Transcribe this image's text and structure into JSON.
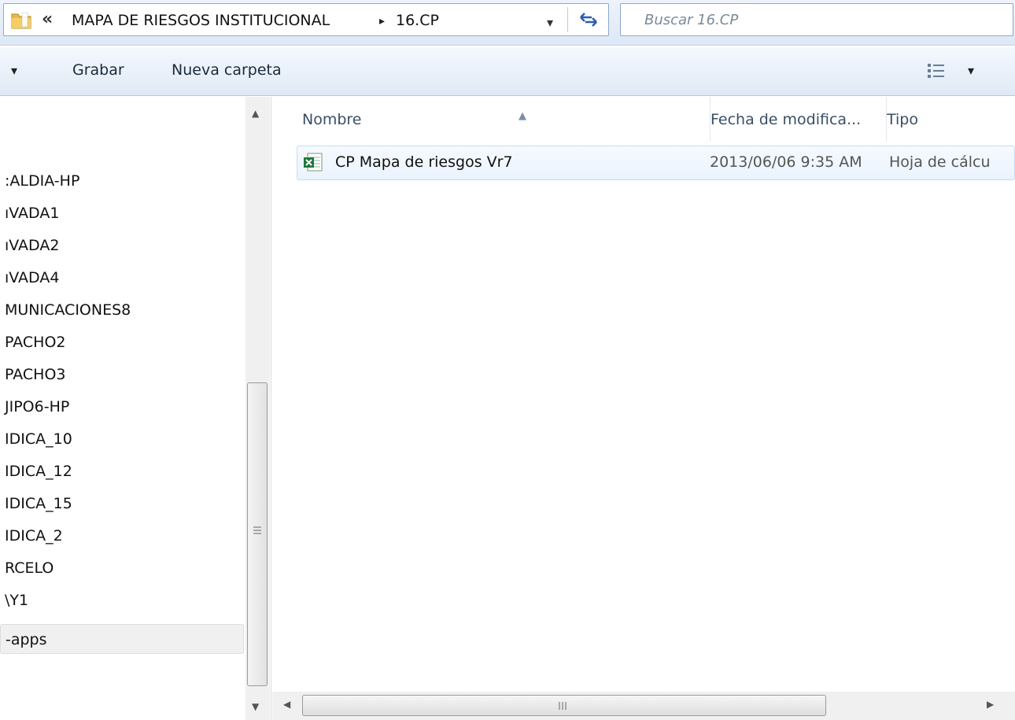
{
  "address": {
    "overflow_chevron": "«",
    "breadcrumb": [
      "MAPA DE  RIESGOS INSTITUCIONAL",
      "16.CP"
    ],
    "separator": "▸",
    "dropdown": "▾"
  },
  "search": {
    "placeholder": "Buscar 16.CP"
  },
  "toolbar": {
    "dropdown": "▾",
    "grabar_label": "Grabar",
    "nueva_carpeta_label": "Nueva carpeta",
    "view_dropdown": "▾"
  },
  "nav": {
    "items": [
      ":ALDIA-HP",
      "ıVADA1",
      "ıVADA2",
      "ıVADA4",
      "MUNICACIONES8",
      "PACHO2",
      "PACHO3",
      "JIPO6-HP",
      "IDICA_10",
      "IDICA_12",
      "IDICA_15",
      "IDICA_2",
      "RCELO",
      "\\Y1",
      "-apps"
    ],
    "selected_index": 14
  },
  "scroll": {
    "up": "▲",
    "down": "▼",
    "left": "◀",
    "right": "▶"
  },
  "columns": {
    "name": "Nombre",
    "date": "Fecha de modifica...",
    "type": "Tipo",
    "sort": "▲"
  },
  "files": [
    {
      "name": "CP Mapa de riesgos Vr7",
      "date": "2013/06/06 9:35 AM",
      "type": "Hoja de cálcu"
    }
  ]
}
